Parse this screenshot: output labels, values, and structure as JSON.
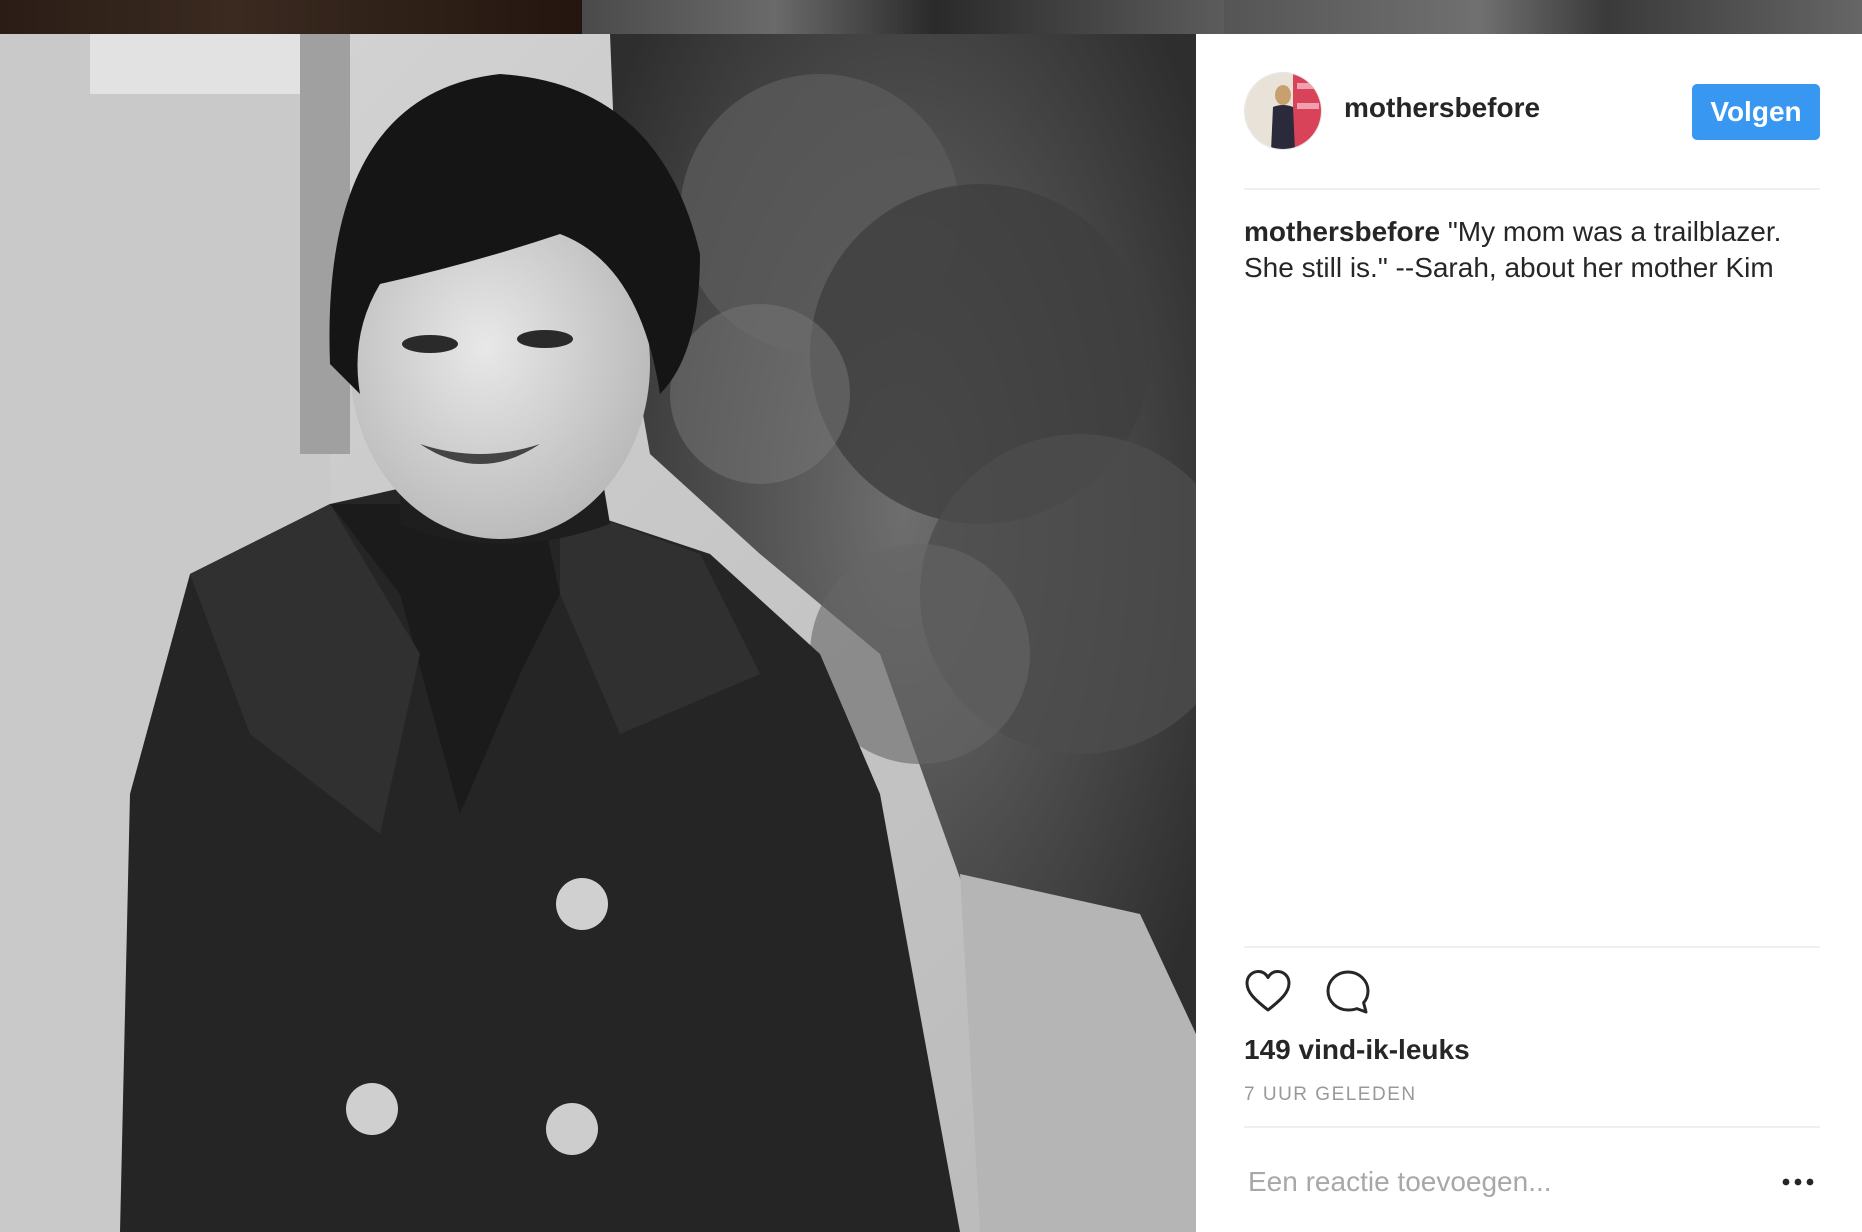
{
  "post": {
    "username": "mothersbefore",
    "follow_label": "Volgen",
    "caption": {
      "username": "mothersbefore",
      "text": "\"My mom was a trailblazer. She still is.\" --Sarah, about her mother Kim"
    },
    "likes": "149 vind-ik-leuks",
    "timestamp": "7 UUR GELEDEN",
    "comment_placeholder": "Een reactie toevoegen..."
  },
  "colors": {
    "accent": "#3897f0",
    "text": "#262626",
    "muted": "#999999",
    "divider": "#efefef"
  },
  "icons": {
    "like": "heart-icon",
    "comment": "comment-icon",
    "more": "more-icon"
  }
}
